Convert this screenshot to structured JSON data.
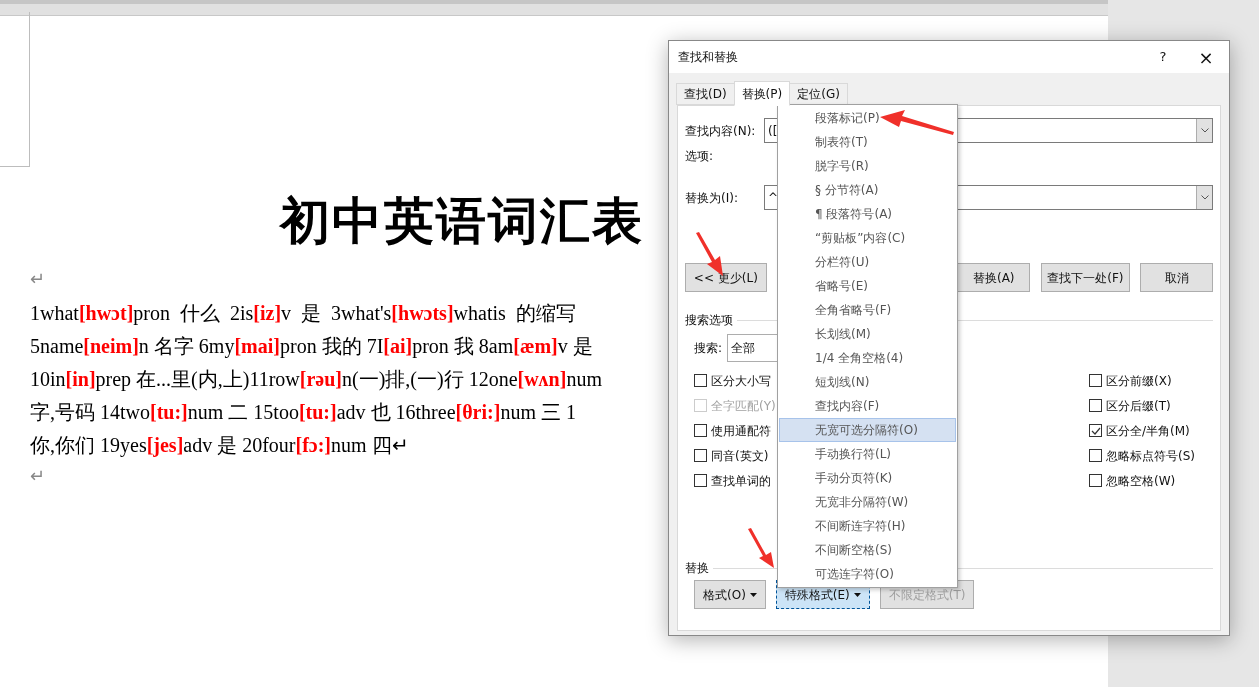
{
  "document": {
    "title": "初中英语词汇表",
    "lines": [
      [
        {
          "text": "1what"
        },
        {
          "text": "[hwɔt]",
          "kind": "phonetic"
        },
        {
          "text": "pron  什么  2is"
        },
        {
          "text": "[iz]",
          "kind": "phonetic"
        },
        {
          "text": "v  是  3what's"
        },
        {
          "text": "[hwɔts]",
          "kind": "phonetic"
        },
        {
          "text": "whatis  的缩写"
        }
      ],
      [
        {
          "text": "5name"
        },
        {
          "text": "[neim]",
          "kind": "phonetic"
        },
        {
          "text": "n 名字 6my"
        },
        {
          "text": "[mai]",
          "kind": "phonetic"
        },
        {
          "text": "pron 我的 7I"
        },
        {
          "text": "[ai]",
          "kind": "phonetic"
        },
        {
          "text": "pron 我 8am"
        },
        {
          "text": "[æm]",
          "kind": "phonetic"
        },
        {
          "text": "v 是"
        }
      ],
      [
        {
          "text": "10in"
        },
        {
          "text": "[in]",
          "kind": "phonetic"
        },
        {
          "text": "prep 在...里(内,上)11row"
        },
        {
          "text": "[rəu]",
          "kind": "phonetic"
        },
        {
          "text": "n(一)排,(一)行 12one"
        },
        {
          "text": "[wʌn]",
          "kind": "phonetic"
        },
        {
          "text": "num"
        }
      ],
      [
        {
          "text": "字,号码 14two"
        },
        {
          "text": "[tu:]",
          "kind": "phonetic"
        },
        {
          "text": "num 二 15too"
        },
        {
          "text": "[tu:]",
          "kind": "phonetic"
        },
        {
          "text": "adv 也 16three"
        },
        {
          "text": "[θri:]",
          "kind": "phonetic"
        },
        {
          "text": "num 三 1"
        }
      ],
      [
        {
          "text": "你,你们 19yes"
        },
        {
          "text": "[jes]",
          "kind": "phonetic"
        },
        {
          "text": "adv 是 20four"
        },
        {
          "text": "[fɔ:]",
          "kind": "phonetic"
        },
        {
          "text": "num 四↵"
        }
      ]
    ],
    "paragraph_mark": "↵",
    "trailing_mark": "↵"
  },
  "dialog": {
    "title": "查找和替换",
    "help": "?",
    "close": "×",
    "tabs": [
      {
        "label": "查找(D)",
        "selected": false
      },
      {
        "label": "替换(P)",
        "selected": true
      },
      {
        "label": "定位(G)",
        "selected": false
      }
    ],
    "find_label": "查找内容(N):",
    "find_value": "([",
    "options_label": "选项:",
    "replace_label": "替换为(I):",
    "replace_value": "^",
    "buttons": [
      {
        "label": "<< 更少(L)"
      },
      {
        "label": "替换(A)"
      },
      {
        "label": "查找下一处(F)"
      },
      {
        "label": "取消"
      }
    ],
    "search_options_label": "搜索选项",
    "search_label": "搜索:",
    "search_value": "全部",
    "left_options": [
      {
        "label": "区分大小写",
        "checked": false,
        "disabled": false
      },
      {
        "label": "全字匹配(Y)",
        "checked": false,
        "disabled": true
      },
      {
        "label": "使用通配符",
        "checked": false,
        "disabled": false
      },
      {
        "label": "同音(英文)",
        "checked": false,
        "disabled": false
      },
      {
        "label": "查找单词的",
        "checked": false,
        "disabled": false
      }
    ],
    "right_options": [
      {
        "label": "区分前缀(X)",
        "checked": false
      },
      {
        "label": "区分后缀(T)",
        "checked": false
      },
      {
        "label": "区分全/半角(M)",
        "checked": true
      },
      {
        "label": "忽略标点符号(S)",
        "checked": false
      },
      {
        "label": "忽略空格(W)",
        "checked": false
      }
    ],
    "replace_section_label": "替换",
    "bottom_buttons": [
      {
        "label": "格式(O)",
        "disabled": false,
        "active": false,
        "dropdown": true
      },
      {
        "label": "特殊格式(E)",
        "disabled": false,
        "active": true,
        "dropdown": true
      },
      {
        "label": "不限定格式(T)",
        "disabled": true,
        "active": false,
        "dropdown": false
      }
    ]
  },
  "menu": {
    "items": [
      {
        "label": "段落标记(P)",
        "selected": false
      },
      {
        "label": "制表符(T)",
        "selected": false
      },
      {
        "label": "脱字号(R)",
        "selected": false
      },
      {
        "label": "§ 分节符(A)",
        "selected": false
      },
      {
        "label": "¶ 段落符号(A)",
        "selected": false
      },
      {
        "label": "“剪贴板”内容(C)",
        "selected": false
      },
      {
        "label": "分栏符(U)",
        "selected": false
      },
      {
        "label": "省略号(E)",
        "selected": false
      },
      {
        "label": "全角省略号(F)",
        "selected": false
      },
      {
        "label": "长划线(M)",
        "selected": false
      },
      {
        "label": "1/4 全角空格(4)",
        "selected": false
      },
      {
        "label": "短划线(N)",
        "selected": false
      },
      {
        "label": "查找内容(F)",
        "selected": false
      },
      {
        "label": "无宽可选分隔符(O)",
        "selected": true
      },
      {
        "label": "手动换行符(L)",
        "selected": false
      },
      {
        "label": "手动分页符(K)",
        "selected": false
      },
      {
        "label": "无宽非分隔符(W)",
        "selected": false
      },
      {
        "label": "不间断连字符(H)",
        "selected": false
      },
      {
        "label": "不间断空格(S)",
        "selected": false
      },
      {
        "label": "可选连字符(O)",
        "selected": false
      }
    ]
  }
}
